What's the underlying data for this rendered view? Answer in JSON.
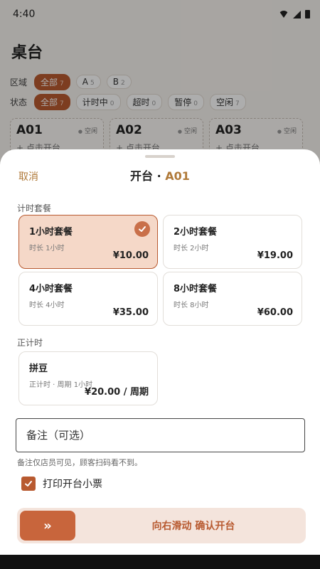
{
  "status_bar": {
    "time": "4:40"
  },
  "background": {
    "page_title": "桌台",
    "area_filter": {
      "label": "区域",
      "chips": [
        {
          "label": "全部",
          "count": "7",
          "active": true
        },
        {
          "label": "A",
          "count": "5",
          "active": false
        },
        {
          "label": "B",
          "count": "2",
          "active": false
        }
      ]
    },
    "status_filter": {
      "label": "状态",
      "chips": [
        {
          "label": "全部",
          "count": "7",
          "active": true
        },
        {
          "label": "计时中",
          "count": "0",
          "active": false
        },
        {
          "label": "超时",
          "count": "0",
          "active": false
        },
        {
          "label": "暂停",
          "count": "0",
          "active": false
        },
        {
          "label": "空闲",
          "count": "7",
          "active": false
        }
      ]
    },
    "tables": [
      {
        "name": "A01",
        "status": "空闲",
        "hint": "+ 点击开台"
      },
      {
        "name": "A02",
        "status": "空闲",
        "hint": "+ 点击开台"
      },
      {
        "name": "A03",
        "status": "空闲",
        "hint": "+ 点击开台"
      }
    ]
  },
  "sheet": {
    "cancel_label": "取消",
    "title_prefix": "开台 · ",
    "table_name": "A01",
    "timed_section_label": "计时套餐",
    "packages": [
      {
        "name": "1小时套餐",
        "duration": "时长 1小时",
        "price": "¥10.00",
        "selected": true
      },
      {
        "name": "2小时套餐",
        "duration": "时长 2小时",
        "price": "¥19.00",
        "selected": false
      },
      {
        "name": "4小时套餐",
        "duration": "时长 4小时",
        "price": "¥35.00",
        "selected": false
      },
      {
        "name": "8小时套餐",
        "duration": "时长 8小时",
        "price": "¥60.00",
        "selected": false
      }
    ],
    "countup_section_label": "正计时",
    "countup_package": {
      "name": "拼豆",
      "detail": "正计时 · 周期 1小时",
      "price": "¥20.00 / 周期"
    },
    "note_placeholder": "备注（可选）",
    "note_help": "备注仅店员可见，顾客扫码看不到。",
    "print_receipt_label": "打印开台小票",
    "print_receipt_checked": true,
    "slider_handle_glyph": "»",
    "slider_label": "向右滑动 确认开台"
  },
  "colors": {
    "accent": "#b85a30",
    "accent_light": "#f5d8c8",
    "cancel_text": "#b07a3a"
  }
}
